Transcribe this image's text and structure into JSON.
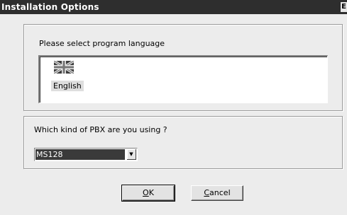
{
  "window": {
    "title": "Installation Options",
    "corner_glyph": "E"
  },
  "language": {
    "prompt": "Please select program language",
    "items": [
      {
        "label": "English",
        "icon": "uk-flag-icon",
        "selected": true
      }
    ]
  },
  "pbx": {
    "prompt": "Which kind of PBX are you using ?",
    "selected": "MS128",
    "dropdown_icon": "chevron-down-icon"
  },
  "buttons": {
    "ok_accel": "O",
    "ok_rest": "K",
    "cancel_accel": "C",
    "cancel_rest": "ancel"
  }
}
